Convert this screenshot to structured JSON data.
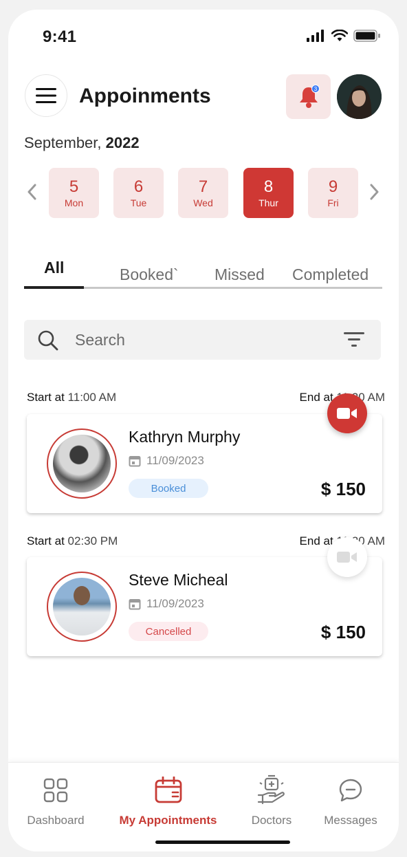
{
  "status_bar": {
    "time": "9:41"
  },
  "header": {
    "title": "Appoinments",
    "notification_count": "3",
    "month": "September,",
    "year": "2022"
  },
  "dates": [
    {
      "num": "5",
      "day": "Mon"
    },
    {
      "num": "6",
      "day": "Tue"
    },
    {
      "num": "7",
      "day": "Wed"
    },
    {
      "num": "8",
      "day": "Thur",
      "selected": true
    },
    {
      "num": "9",
      "day": "Fri"
    }
  ],
  "tabs": [
    {
      "label": "All",
      "active": true
    },
    {
      "label": "Booked`"
    },
    {
      "label": "Missed"
    },
    {
      "label": "Completed"
    }
  ],
  "search": {
    "placeholder": "Search"
  },
  "appointments": [
    {
      "start_label": "Start at",
      "start_time": "11:00 AM",
      "end_label": "End at",
      "end_time": "11:20 AM",
      "name": "Kathryn Murphy",
      "date": "11/09/2023",
      "status": "Booked",
      "price": "$ 150",
      "video_active": true
    },
    {
      "start_label": "Start at",
      "start_time": "02:30 PM",
      "end_label": "End at",
      "end_time": "11:20 AM",
      "name": "Steve Micheal",
      "date": "11/09/2023",
      "status": "Cancelled",
      "price": "$ 150",
      "video_active": false
    }
  ],
  "bottom_nav": [
    {
      "label": "Dashboard",
      "icon": "grid-icon"
    },
    {
      "label": "My Appointments",
      "icon": "calendar-icon",
      "active": true
    },
    {
      "label": "Doctors",
      "icon": "medical-hand-icon"
    },
    {
      "label": "Messages",
      "icon": "chat-icon"
    }
  ],
  "colors": {
    "accent": "#cf3834",
    "accent_soft": "#f7e6e6",
    "booked": "#4a8fd8",
    "cancelled": "#d4484a"
  }
}
